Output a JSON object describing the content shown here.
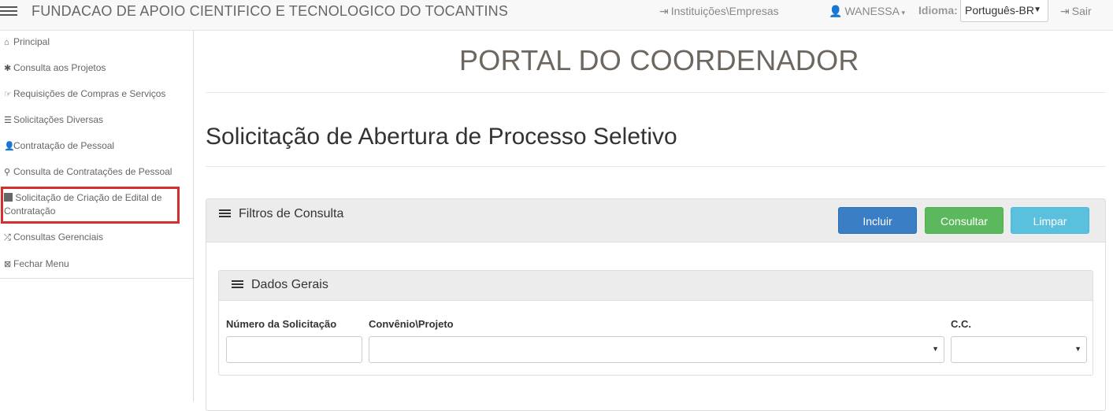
{
  "header": {
    "brand": "FUNDACAO DE APOIO CIENTIFICO E TECNOLOGICO DO TOCANTINS",
    "institutions_link": "Instituições\\Empresas",
    "user_name": "WANESSA",
    "language_label": "Idioma:",
    "language_selected": "Português-BR",
    "logout_label": "Sair"
  },
  "sidebar": {
    "items": [
      {
        "label": "Principal",
        "icon": "home-icon"
      },
      {
        "label": "Consulta aos Projetos",
        "icon": "asterisk-icon"
      },
      {
        "label": "Requisições de Compras e Serviços",
        "icon": "hand-point-icon"
      },
      {
        "label": "Solicitações Diversas",
        "icon": "list-icon"
      },
      {
        "label": "Contratação de Pessoal",
        "icon": "user-icon"
      },
      {
        "label": "Consulta de Contratações de Pessoal",
        "icon": "search-icon"
      },
      {
        "label": "Solicitação de Criação de Edital de Contratação",
        "icon": "book-icon"
      },
      {
        "label": "Consultas Gerenciais",
        "icon": "random-icon"
      },
      {
        "label": "Fechar Menu",
        "icon": "close-box-icon"
      }
    ]
  },
  "main": {
    "portal_title": "PORTAL DO COORDENADOR",
    "page_title": "Solicitação de Abertura de Processo Seletivo",
    "filter_panel": {
      "title": "Filtros de Consulta",
      "buttons": {
        "incluir": "Incluir",
        "consultar": "Consultar",
        "limpar": "Limpar"
      }
    },
    "general_panel": {
      "title": "Dados Gerais",
      "fields": {
        "numero_label": "Número da Solicitação",
        "numero_value": "",
        "convenio_label": "Convênio\\Projeto",
        "convenio_value": "",
        "cc_label": "C.C.",
        "cc_value": ""
      }
    }
  },
  "colors": {
    "incluir": "#3a7fc6",
    "consultar": "#5cb85c",
    "limpar": "#5bc0de",
    "highlight_border": "#d32f2f"
  }
}
